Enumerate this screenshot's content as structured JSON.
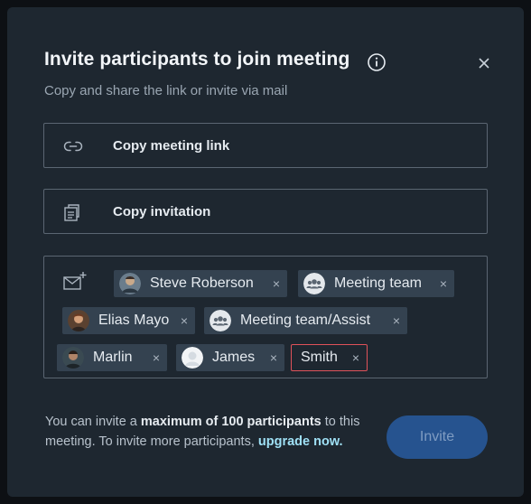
{
  "dialog": {
    "title": "Invite participants to join meeting",
    "subtitle": "Copy and share the link or invite via mail",
    "actions": [
      {
        "label": "Copy meeting link",
        "icon": "link-icon"
      },
      {
        "label": "Copy invitation",
        "icon": "copy-icon"
      }
    ],
    "recipients": [
      {
        "name": "Steve Roberson",
        "avatar": "photo",
        "remove": "×"
      },
      {
        "name": "Meeting team",
        "avatar": "group-icon",
        "remove": "×"
      },
      {
        "name": "Elias Mayo",
        "avatar": "photo",
        "remove": "×"
      },
      {
        "name": "Meeting team/Assist",
        "avatar": "group-icon",
        "remove": "×"
      },
      {
        "name": "Marlin",
        "avatar": "photo",
        "remove": "×"
      },
      {
        "name": "James",
        "avatar": "placeholder",
        "remove": "×"
      },
      {
        "name": "Smith",
        "avatar": "none",
        "remove": "×",
        "state": "invalid"
      }
    ],
    "note": {
      "prefix": "You can invite a ",
      "bold": "maximum of 100 participants",
      "middle": " to this meeting. To invite more participants, ",
      "link": "upgrade now."
    },
    "invite_label": "Invite",
    "colors": {
      "accent": "#26538f",
      "link": "#9fe0f5",
      "error": "#e0525a",
      "chip": "#344250"
    }
  }
}
